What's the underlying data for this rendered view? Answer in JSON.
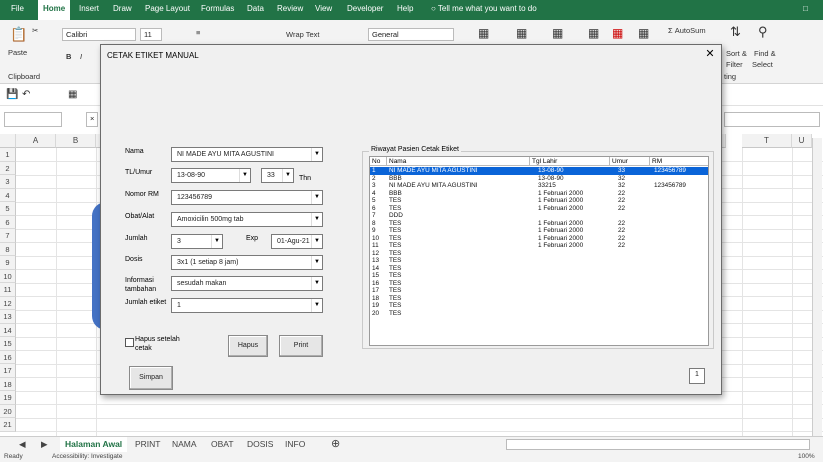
{
  "ribbon": {
    "tabs": [
      "File",
      "Home",
      "Insert",
      "Draw",
      "Page Layout",
      "Formulas",
      "Data",
      "Review",
      "View",
      "Developer",
      "Help"
    ],
    "active_tab": "Home",
    "tell_me": "Tell me what you want to do",
    "paste": "Paste",
    "clipboard": "Clipboard",
    "font_name": "Calibri",
    "font_size": "11",
    "wrap_text": "Wrap Text",
    "number_format": "General",
    "autosum": "AutoSum",
    "sort_filter": "Sort &",
    "filter": "Filter",
    "find_select": "Find &",
    "select": "Select",
    "editing_partial": "ting"
  },
  "columns": [
    "A",
    "B",
    "T",
    "U"
  ],
  "rows": [
    "1",
    "2",
    "3",
    "4",
    "5",
    "6",
    "7",
    "8",
    "9",
    "10",
    "11",
    "12",
    "13",
    "14",
    "15",
    "16",
    "17",
    "18",
    "19",
    "20",
    "21"
  ],
  "sheet_tabs": [
    "Halaman Awal",
    "PRINT",
    "NAMA",
    "OBAT",
    "DOSIS",
    "INFO"
  ],
  "active_sheet": "Halaman Awal",
  "status": {
    "ready": "Ready",
    "accessibility": "Accessibility: Investigate",
    "zoom": "100%"
  },
  "dialog": {
    "title": "CETAK ETIKET MANUAL",
    "fields": {
      "nama_label": "Nama",
      "nama_value": "NI MADE AYU MITA AGUSTINI",
      "ttl_label": "TL/Umur",
      "ttl_value": "13-08-90",
      "umur_value": "33",
      "thn_label": "Thn",
      "rm_label": "Nomor RM",
      "rm_value": "123456789",
      "obat_label": "Obat/Alat",
      "obat_value": "Amoxicilin 500mg tab",
      "jumlah_label": "Jumlah",
      "jumlah_value": "3",
      "exp_label": "Exp",
      "exp_value": "01-Agu-21",
      "dosis_label": "Dosis",
      "dosis_value": "3x1 (1 setiap 8 jam)",
      "info_label_1": "Informasi",
      "info_label_2": "tambahan",
      "info_value": "sesudah makan",
      "jumlah_etiket_label": "Jumlah etiket",
      "jumlah_etiket_value": "1"
    },
    "checkbox_label_1": "Hapus setelah",
    "checkbox_label_2": "cetak",
    "hapus_button": "Hapus",
    "print_button": "Print",
    "simpan_button": "Simpan",
    "history_title": "Riwayat Pasien Cetak Etiket",
    "history_headers": [
      "No",
      "Nama",
      "Tgl Lahir",
      "Umur",
      "RM"
    ],
    "history_rows": [
      [
        "1",
        "NI MADE AYU MITA AGUSTINI",
        "13-08-90",
        "33",
        "123456789"
      ],
      [
        "2",
        "BBB",
        "13-08-90",
        "32",
        ""
      ],
      [
        "3",
        "NI MADE AYU MITA AGUSTINI",
        "33215",
        "32",
        "123456789"
      ],
      [
        "4",
        "BBB",
        "1 Februari  2000",
        "22",
        ""
      ],
      [
        "5",
        "TES",
        "1 Februari  2000",
        "22",
        ""
      ],
      [
        "6",
        "TES",
        "1 Februari  2000",
        "22",
        ""
      ],
      [
        "7",
        "DDD",
        "",
        "",
        ""
      ],
      [
        "8",
        "TES",
        "1 Februari  2000",
        "22",
        ""
      ],
      [
        "9",
        "TES",
        "1 Februari  2000",
        "22",
        ""
      ],
      [
        "10",
        "TES",
        "1 Februari  2000",
        "22",
        ""
      ],
      [
        "11",
        "TES",
        "1 Februari  2000",
        "22",
        ""
      ],
      [
        "12",
        "TES",
        "",
        "",
        ""
      ],
      [
        "13",
        "TES",
        "",
        "",
        ""
      ],
      [
        "14",
        "TES",
        "",
        "",
        ""
      ],
      [
        "15",
        "TES",
        "",
        "",
        ""
      ],
      [
        "16",
        "TES",
        "",
        "",
        ""
      ],
      [
        "17",
        "TES",
        "",
        "",
        ""
      ],
      [
        "18",
        "TES",
        "",
        "",
        ""
      ],
      [
        "19",
        "TES",
        "",
        "",
        ""
      ],
      [
        "20",
        "TES",
        "",
        "",
        ""
      ]
    ],
    "selected_row": 0,
    "page_value": "1"
  },
  "colors": {
    "excel_green": "#217346",
    "selection_blue": "#0a64d8",
    "dialog_bg": "#f0f0f0"
  }
}
